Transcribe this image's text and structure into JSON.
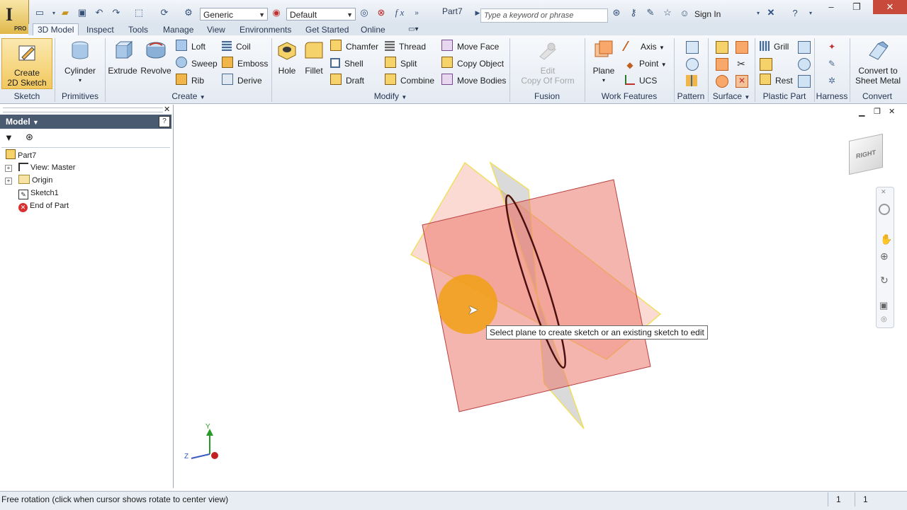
{
  "app": {
    "badge": "PRO",
    "document_title": "Part7"
  },
  "quick_access": {
    "material": "Generic",
    "appearance": "Default",
    "fx_label": "f x"
  },
  "search": {
    "placeholder": "Type a keyword or phrase"
  },
  "account": {
    "sign_in": "Sign In"
  },
  "tabs": [
    "3D Model",
    "Inspect",
    "Tools",
    "Manage",
    "View",
    "Environments",
    "Get Started",
    "Online"
  ],
  "ribbon": {
    "sketch": {
      "button_line1": "Create",
      "button_line2": "2D Sketch",
      "group": "Sketch"
    },
    "primitives": {
      "button": "Cylinder",
      "group": "Primitives"
    },
    "create": {
      "extrude": "Extrude",
      "revolve": "Revolve",
      "loft": "Loft",
      "sweep": "Sweep",
      "rib": "Rib",
      "coil": "Coil",
      "emboss": "Emboss",
      "derive": "Derive",
      "group": "Create"
    },
    "modify": {
      "hole": "Hole",
      "fillet": "Fillet",
      "chamfer": "Chamfer",
      "shell": "Shell",
      "draft": "Draft",
      "thread": "Thread",
      "split": "Split",
      "combine": "Combine",
      "move_face": "Move Face",
      "copy_object": "Copy Object",
      "move_bodies": "Move Bodies",
      "group": "Modify"
    },
    "fusion": {
      "edit": "Edit",
      "copy_of_form": "Copy Of Form",
      "group": "Fusion"
    },
    "work_features": {
      "plane": "Plane",
      "axis": "Axis",
      "point": "Point",
      "ucs": "UCS",
      "group": "Work Features"
    },
    "pattern": {
      "group": "Pattern"
    },
    "surface": {
      "group": "Surface"
    },
    "plastic_part": {
      "grill": "Grill",
      "rest": "Rest",
      "group": "Plastic Part"
    },
    "harness": {
      "group": "Harness"
    },
    "convert": {
      "button_line1": "Convert to",
      "button_line2": "Sheet Metal",
      "group": "Convert"
    }
  },
  "browser": {
    "title": "Model",
    "tree": [
      "Part7",
      "View: Master",
      "Origin",
      "Sketch1",
      "End of Part"
    ]
  },
  "viewport": {
    "viewcube_label": "RIGHT",
    "tooltip": "Select plane to create sketch or an existing sketch to edit",
    "triad": {
      "y": "Y",
      "z": "Z"
    }
  },
  "status": {
    "text": "Free rotation (click when cursor shows rotate to center view)",
    "count1": "1",
    "count2": "1"
  }
}
